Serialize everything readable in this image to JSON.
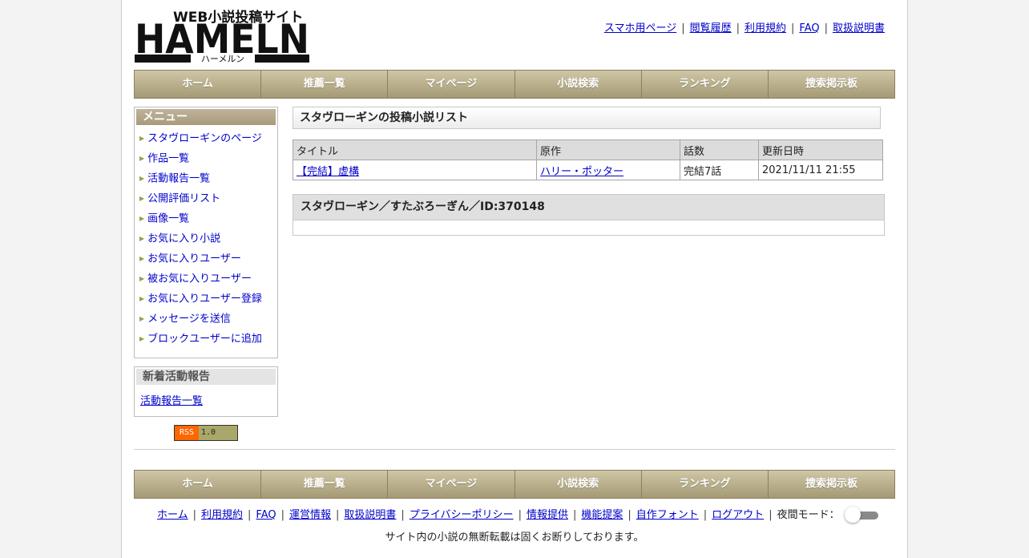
{
  "site": {
    "logo_top": "WEB小説投稿サイト",
    "logo_main": "HAMELN",
    "logo_kana": "ハーメルン"
  },
  "top_links": [
    "スマホ用ページ",
    "閲覧履歴",
    "利用規約",
    "FAQ",
    "取扱説明書"
  ],
  "nav": [
    "ホーム",
    "推薦一覧",
    "マイページ",
    "小説検索",
    "ランキング",
    "捜索掲示板"
  ],
  "menu": {
    "title": "メニュー",
    "items": [
      "スタヴローギンのページ",
      "作品一覧",
      "活動報告一覧",
      "公開評価リスト",
      "画像一覧",
      "お気に入り小説",
      "お気に入りユーザー",
      "被お気に入りユーザー",
      "お気に入りユーザー登録",
      "メッセージを送信",
      "ブロックユーザーに追加"
    ]
  },
  "news": {
    "title": "新着活動報告",
    "link": "活動報告一覧"
  },
  "rss": {
    "left": "RSS",
    "right": "1.0"
  },
  "main": {
    "title": "スタヴローギンの投稿小説リスト",
    "table": {
      "headers": [
        "タイトル",
        "原作",
        "話数",
        "更新日時"
      ],
      "rows": [
        {
          "title": "【完結】虚構",
          "original": "ハリー・ポッター",
          "episodes": "完結7話",
          "updated": "2021/11/11 21:55"
        }
      ]
    },
    "user_header": "スタヴローギン／すたぶろーぎん／ID:370148"
  },
  "footer": {
    "links": [
      "ホーム",
      "利用規約",
      "FAQ",
      "運営情報",
      "取扱説明書",
      "プライバシーポリシー",
      "情報提供",
      "機能提案",
      "自作フォント",
      "ログアウト"
    ],
    "night_mode_label": "夜間モード：",
    "copyright": "サイト内の小説の無断転載は固くお断りしております。"
  }
}
